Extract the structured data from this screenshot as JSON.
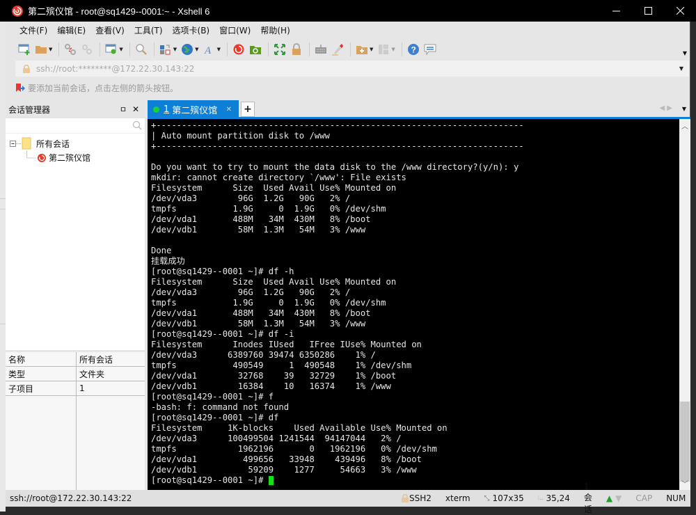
{
  "window": {
    "title": "第二殡仪馆 - root@sq1429--0001:~ - Xshell 6"
  },
  "menu": [
    "文件(F)",
    "编辑(E)",
    "查看(V)",
    "工具(T)",
    "选项卡(B)",
    "窗口(W)",
    "帮助(H)"
  ],
  "toolbar": {
    "icons": [
      "new-session-icon",
      "open-folder-icon",
      "disconnect-icon",
      "reconnect-icon",
      "session-properties-icon",
      "find-icon",
      "transfer-icon",
      "globe-icon",
      "font-icon",
      "xshell-icon",
      "xftp-icon",
      "fullscreen-icon",
      "lock-icon",
      "keyboard-icon",
      "highlight-icon",
      "new-folder-icon",
      "layout-icon",
      "help-icon",
      "chat-icon"
    ]
  },
  "address": {
    "url": "ssh://root:********@172.22.30.143:22"
  },
  "hint": {
    "text": "要添加当前会话，点击左侧的箭头按钮。"
  },
  "session_manager": {
    "title": "会话管理器",
    "tree": {
      "root": "所有会话",
      "children": [
        "第二殡仪馆"
      ]
    },
    "properties": [
      {
        "key": "名称",
        "value": "所有会话"
      },
      {
        "key": "类型",
        "value": "文件夹"
      },
      {
        "key": "子项目",
        "value": "1"
      }
    ]
  },
  "tabs": [
    {
      "number": "1",
      "label": "第二殡仪馆",
      "status_color": "#18d13b"
    }
  ],
  "terminal": {
    "lines": [
      "+------------------------------------------------------------------------",
      "| Auto mount partition disk to /www",
      "+------------------------------------------------------------------------",
      "",
      "Do you want to try to mount the data disk to the /www directory?(y/n): y",
      "mkdir: cannot create directory `/www': File exists",
      "Filesystem      Size  Used Avail Use% Mounted on",
      "/dev/vda3        96G  1.2G   90G   2% /",
      "tmpfs           1.9G     0  1.9G   0% /dev/shm",
      "/dev/vda1       488M   34M  430M   8% /boot",
      "/dev/vdb1        58M  1.3M   54M   3% /www",
      "",
      "Done",
      "挂载成功",
      "[root@sq1429--0001 ~]# df -h",
      "Filesystem      Size  Used Avail Use% Mounted on",
      "/dev/vda3        96G  1.2G   90G   2% /",
      "tmpfs           1.9G     0  1.9G   0% /dev/shm",
      "/dev/vda1       488M   34M  430M   8% /boot",
      "/dev/vdb1        58M  1.3M   54M   3% /www",
      "[root@sq1429--0001 ~]# df -i",
      "Filesystem      Inodes IUsed   IFree IUse% Mounted on",
      "/dev/vda3      6389760 39474 6350286    1% /",
      "tmpfs           490549     1  490548    1% /dev/shm",
      "/dev/vda1        32768    39   32729    1% /boot",
      "/dev/vdb1        16384    10   16374    1% /www",
      "[root@sq1429--0001 ~]# f",
      "-bash: f: command not found",
      "[root@sq1429--0001 ~]# df",
      "Filesystem     1K-blocks    Used Available Use% Mounted on",
      "/dev/vda3      100499504 1241544  94147044   2% /",
      "tmpfs            1962196       0   1962196   0% /dev/shm",
      "/dev/vda1         499656   33948    439496   8% /boot",
      "/dev/vdb1          59209    1277     54663   3% /www"
    ],
    "prompt": "[root@sq1429--0001 ~]# "
  },
  "statusbar": {
    "connection": "ssh://root@172.22.30.143:22",
    "protocol": "SSH2",
    "terminal_type": "xterm",
    "size": "107x35",
    "cursor_pos": "35,24",
    "sessions": "1 会话",
    "cap": "CAP",
    "num": "NUM"
  }
}
